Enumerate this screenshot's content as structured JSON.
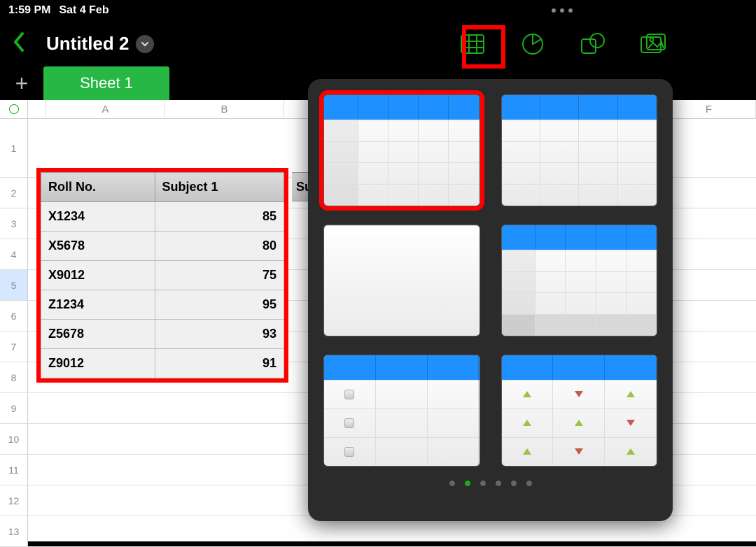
{
  "status": {
    "time": "1:59 PM",
    "date": "Sat 4 Feb"
  },
  "header": {
    "title": "Untitled 2",
    "tools": [
      "table",
      "chart",
      "shape",
      "media"
    ]
  },
  "tabs": {
    "add": "+",
    "active": "Sheet 1"
  },
  "columns": [
    "A",
    "B",
    "F"
  ],
  "row_numbers": [
    1,
    2,
    3,
    4,
    5,
    6,
    7,
    8,
    9,
    10,
    11,
    12,
    13
  ],
  "selected_row": 5,
  "partial_header": "Su",
  "data_table": {
    "headers": [
      "Roll No.",
      "Subject 1"
    ],
    "rows": [
      {
        "roll": "X1234",
        "val": 85
      },
      {
        "roll": "X5678",
        "val": 80
      },
      {
        "roll": "X9012",
        "val": 75
      },
      {
        "roll": "Z1234",
        "val": 95
      },
      {
        "roll": "Z5678",
        "val": 93
      },
      {
        "roll": "Z9012",
        "val": 91
      }
    ]
  },
  "popup": {
    "selected_index": 0,
    "page_count": 6,
    "active_page": 1
  }
}
